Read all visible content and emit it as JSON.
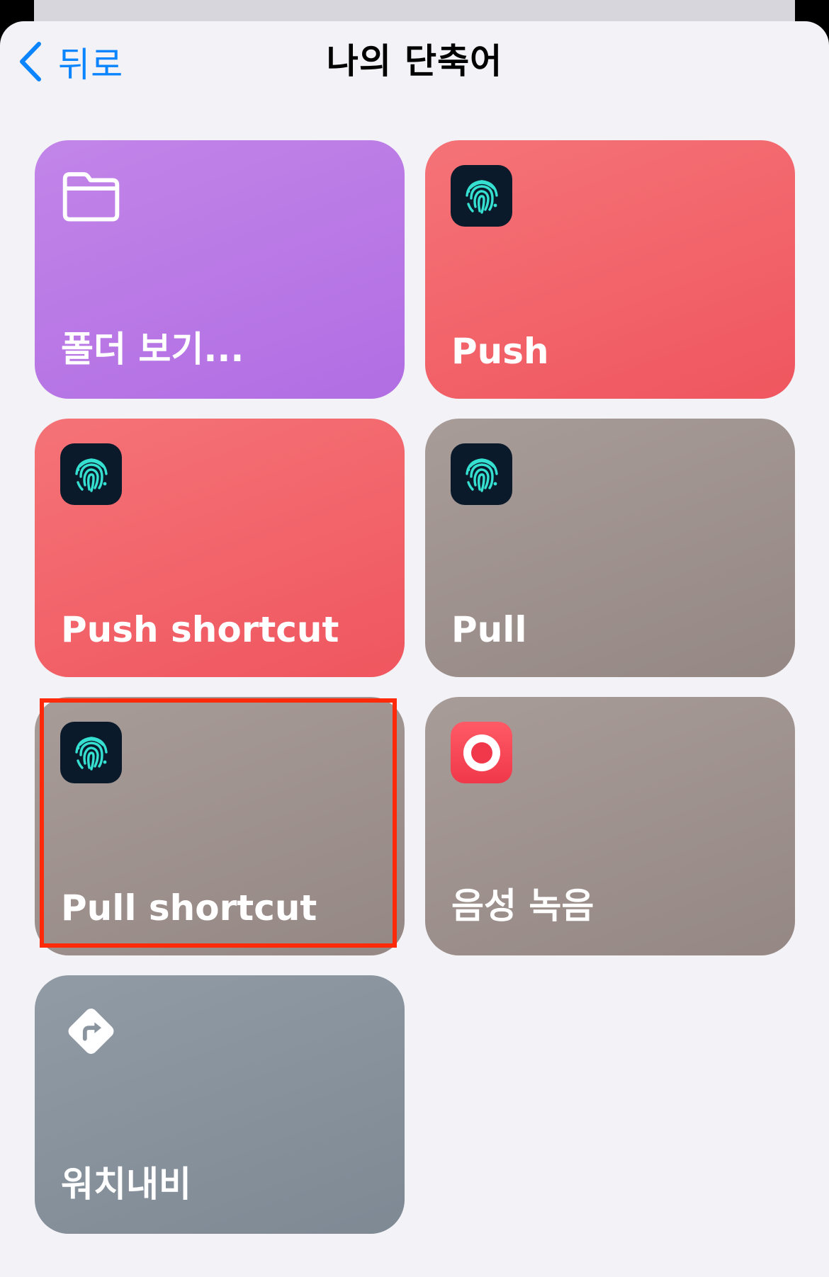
{
  "nav": {
    "back_label": "뒤로",
    "title": "나의 단축어"
  },
  "colors": {
    "accent": "#0a84ff",
    "background": "#f2f2f7",
    "highlight": "#ff2a0a"
  },
  "tiles": [
    {
      "label": "폴더 보기...",
      "icon": "folder-icon",
      "color": "purple"
    },
    {
      "label": "Push",
      "icon": "fingerprint-app-icon",
      "color": "red"
    },
    {
      "label": "Push shortcut",
      "icon": "fingerprint-app-icon",
      "color": "red"
    },
    {
      "label": "Pull",
      "icon": "fingerprint-app-icon",
      "color": "taupe"
    },
    {
      "label": "Pull shortcut",
      "icon": "fingerprint-app-icon",
      "color": "taupe",
      "highlighted": true
    },
    {
      "label": "음성 녹음",
      "icon": "voice-memo-icon",
      "color": "taupe"
    },
    {
      "label": "워치내비",
      "icon": "directions-icon",
      "color": "slate"
    }
  ]
}
